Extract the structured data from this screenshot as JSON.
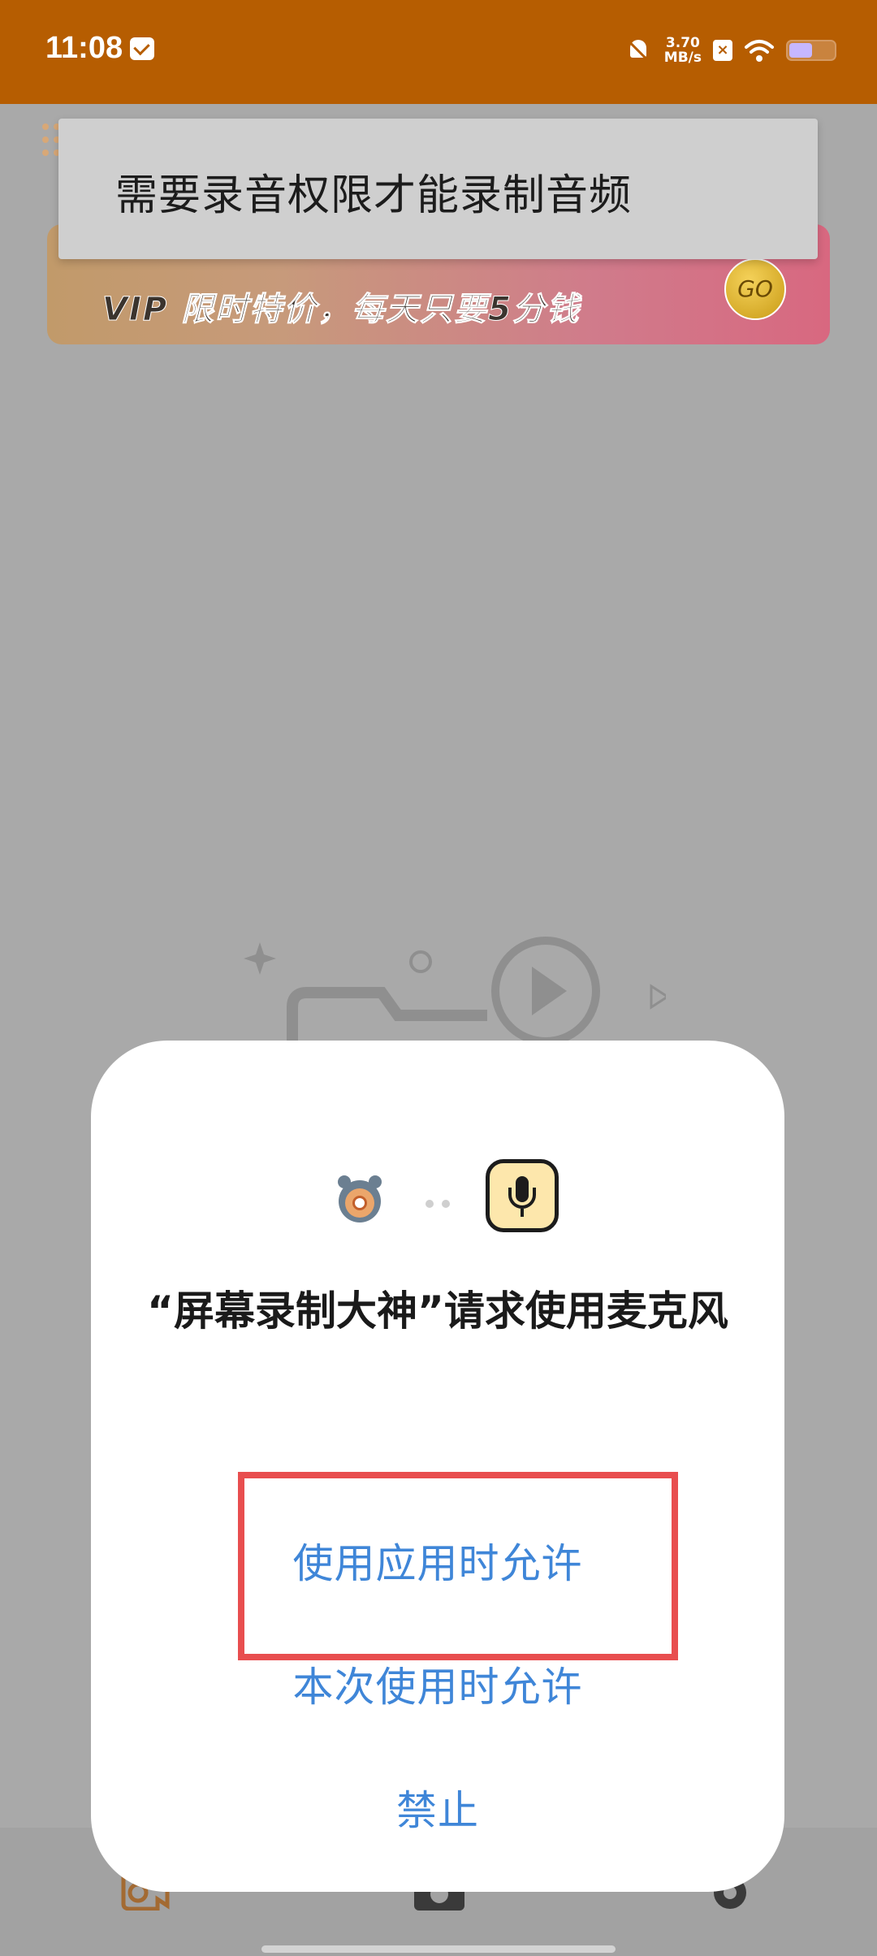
{
  "status_bar": {
    "time": "11:08",
    "net_speed_value": "3.70",
    "net_speed_unit": "MB/s",
    "icons": [
      "mail-icon",
      "bell-muted-icon",
      "x-box-icon",
      "wifi-icon",
      "battery-icon"
    ]
  },
  "toast": {
    "text": "需要录音权限才能录制音频"
  },
  "vip_banner": {
    "text": "VIP 限时特价，每天只要5分钱",
    "go_label": "GO"
  },
  "permission_dialog": {
    "title": "“屏幕录制大神”请求使用麦克风",
    "icons": [
      "app-icon",
      "microphone-icon"
    ],
    "buttons": {
      "allow_while_using": "使用应用时允许",
      "allow_once": "本次使用时允许",
      "deny": "禁止"
    }
  },
  "bottom_nav": {
    "items": [
      "record-icon",
      "camera-icon",
      "settings-icon"
    ]
  },
  "colors": {
    "status_bar": "#b65d01",
    "scrim_background": "#a9a9a9",
    "dialog_background": "#ffffff",
    "dialog_button": "#3f86d8",
    "highlight": "#e84e4f"
  }
}
